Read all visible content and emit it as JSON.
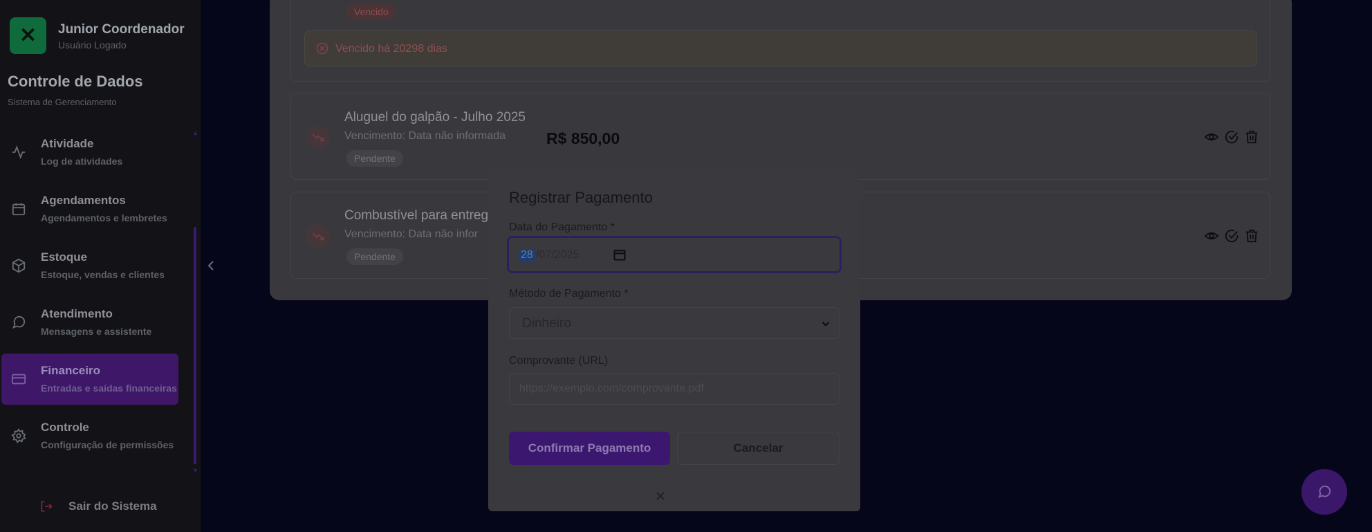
{
  "user": {
    "name": "Junior Coordenador",
    "status": "Usuário Logado",
    "logo_glyph": "✕"
  },
  "app": {
    "title": "Controle de Dados",
    "subtitle": "Sistema de Gerenciamento"
  },
  "sidebar": {
    "items": [
      {
        "label": "Atividade",
        "desc": "Log de atividades",
        "icon": "activity-icon"
      },
      {
        "label": "Agendamentos",
        "desc": "Agendamentos e lembretes",
        "icon": "calendar-icon"
      },
      {
        "label": "Estoque",
        "desc": "Estoque, vendas e clientes",
        "icon": "box-icon"
      },
      {
        "label": "Atendimento",
        "desc": "Mensagens e assistente",
        "icon": "chat-icon"
      },
      {
        "label": "Financeiro",
        "desc": "Entradas e saídas financeiras",
        "icon": "card-icon",
        "active": true
      },
      {
        "label": "Controle",
        "desc": "Configuração de permissões",
        "icon": "gear-icon"
      }
    ],
    "logout_label": "Sair do Sistema"
  },
  "entries": {
    "top_badge": "Vencido",
    "overdue_text": "Vencido há 20298 dias",
    "items": [
      {
        "title": "Aluguel do galpão - Julho 2025",
        "due": "Vencimento: Data não informada",
        "amount": "R$ 850,00",
        "badge": "Pendente"
      },
      {
        "title": "Combustível para entreg",
        "due": "Vencimento: Data não infor",
        "badge": "Pendente"
      }
    ]
  },
  "modal": {
    "title": "Registrar Pagamento",
    "date_label": "Data do Pagamento *",
    "date_day": "28",
    "date_rest": "/07/2025",
    "method_label": "Método de Pagamento *",
    "method_value": "Dinheiro",
    "receipt_label": "Comprovante (URL)",
    "receipt_placeholder": "https://exemplo.com/comprovante.pdf",
    "confirm_label": "Confirmar Pagamento",
    "cancel_label": "Cancelar"
  },
  "colors": {
    "accent": "#3c1770",
    "danger": "#8b4f52",
    "logo": "#0f6b3c"
  }
}
